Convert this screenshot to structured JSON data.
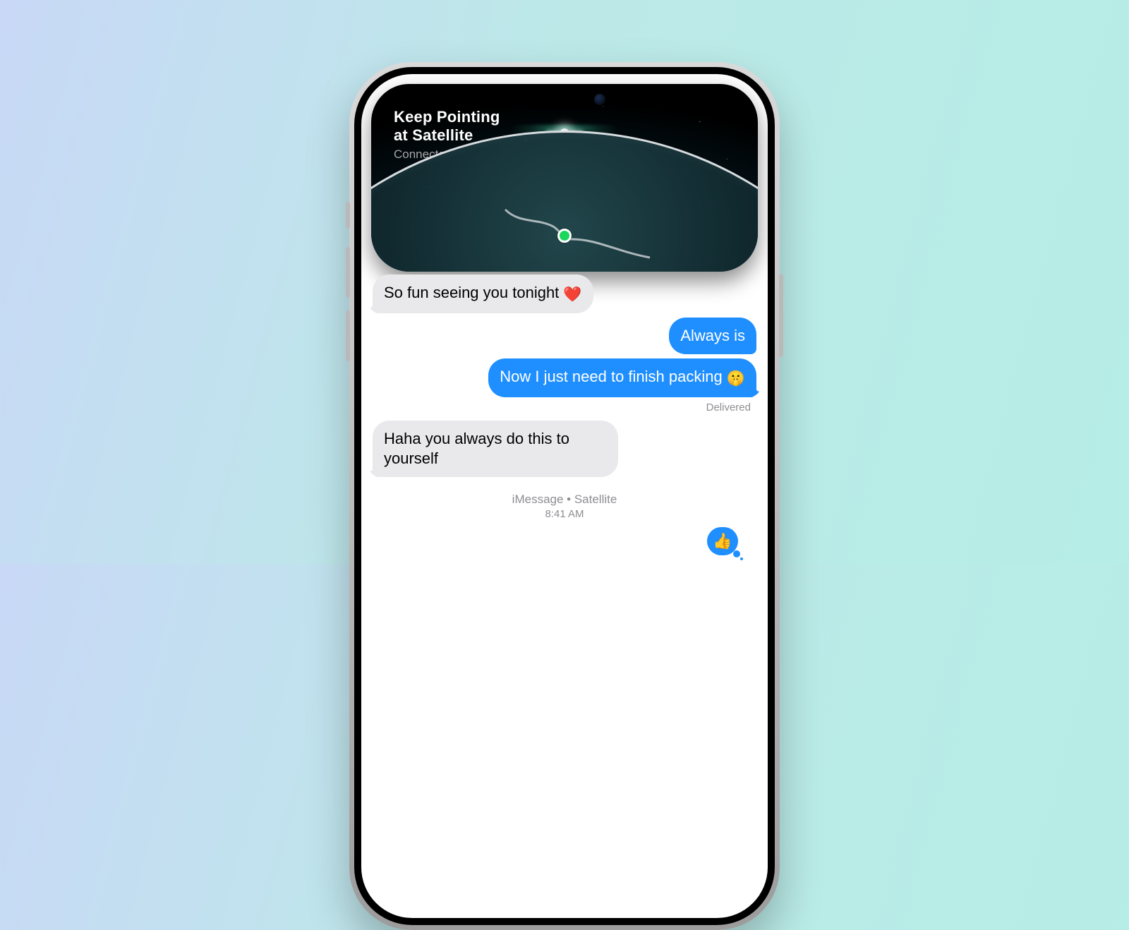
{
  "satellite_panel": {
    "title_line1": "Keep Pointing",
    "title_line2": "at Satellite",
    "status": "Connected"
  },
  "messages": {
    "m0": {
      "text": "So fun seeing you tonight ",
      "emoji": "❤️"
    },
    "m1": {
      "text": "Always is"
    },
    "m2": {
      "text": "Now I just need to finish packing ",
      "emoji": "🤫"
    },
    "delivered_label": "Delivered",
    "m3": {
      "text": "Haha you always do this to yourself"
    },
    "reaction_emoji": "👍"
  },
  "thread_meta": {
    "line1": "iMessage • Satellite",
    "line2": "8:41 AM"
  }
}
